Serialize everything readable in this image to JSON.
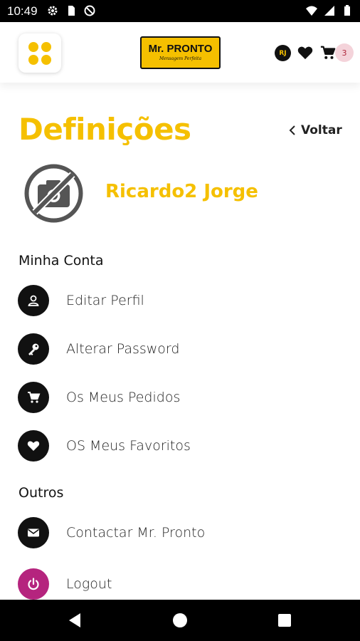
{
  "status_bar": {
    "time": "10:49",
    "left_icons": [
      "gear-icon",
      "sd-card-icon",
      "no-data-icon"
    ],
    "right_icons": [
      "wifi-icon",
      "signal-icon",
      "battery-icon"
    ]
  },
  "header": {
    "logo_text": "Mr. PRONTO",
    "logo_subtext": "Mensagem Perfeita",
    "user_initials": "RJ",
    "cart_count": "3",
    "colors": {
      "accent": "#f5c000",
      "dark": "#111111",
      "badge_bg": "#f4d3da",
      "logout": "#b5247e"
    }
  },
  "page": {
    "title": "Definições",
    "back_label": "Voltar"
  },
  "profile": {
    "name": "Ricardo2 Jorge",
    "photo_icon": "no-camera-icon"
  },
  "sections": {
    "account_title": "Minha Conta",
    "account_items": [
      {
        "label": "Editar Perfil",
        "icon": "user-icon"
      },
      {
        "label": "Alterar Password",
        "icon": "key-icon"
      },
      {
        "label": "Os Meus Pedidos",
        "icon": "cart-icon"
      },
      {
        "label": "OS Meus Favoritos",
        "icon": "heart-icon"
      }
    ],
    "other_title": "Outros",
    "other_items": [
      {
        "label": "Contactar Mr. Pronto",
        "icon": "mail-icon"
      },
      {
        "label": "Logout",
        "icon": "power-icon"
      }
    ]
  }
}
